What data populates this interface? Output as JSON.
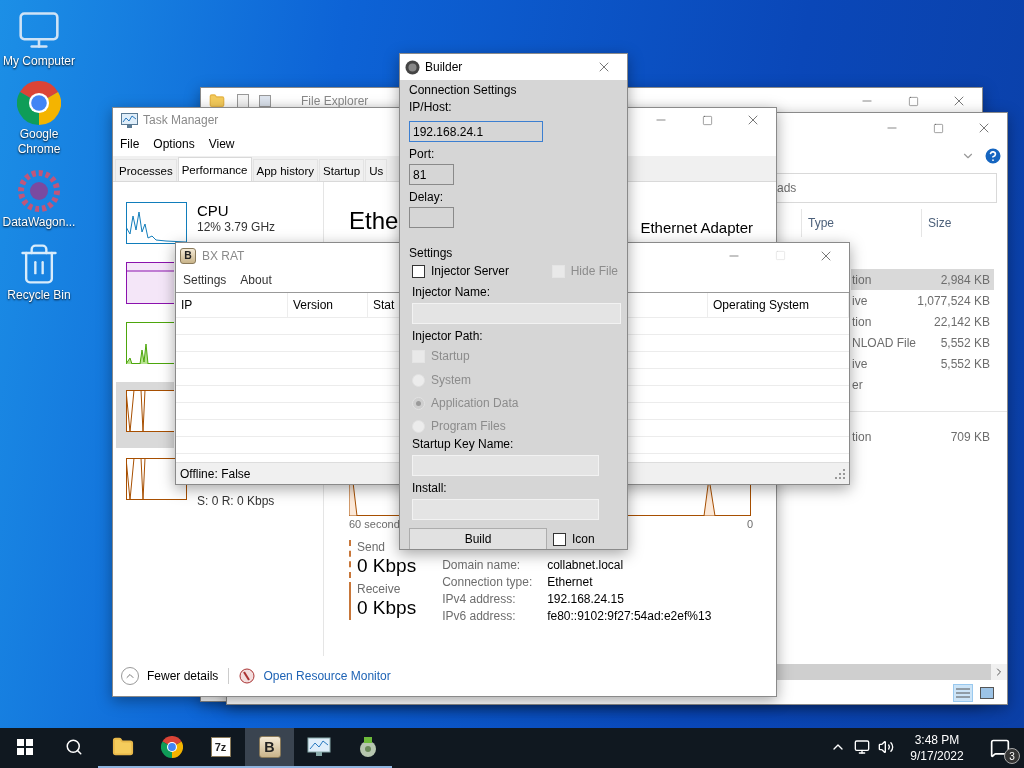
{
  "desktop_icons": [
    {
      "kind": "computer",
      "label": "My Computer"
    },
    {
      "kind": "chrome",
      "label": "Google Chrome"
    },
    {
      "kind": "gear",
      "label": "DataWagon..."
    },
    {
      "kind": "bin",
      "label": "Recycle Bin"
    }
  ],
  "explorer_back": {
    "title": "File Explorer"
  },
  "explorer_front": {
    "search_placeholder": "ads",
    "columns": [
      "Type",
      "Size"
    ],
    "groups": [
      [
        {
          "type": "tion",
          "size": "2,984 KB",
          "selected": true
        },
        {
          "type": "ive",
          "size": "1,077,524 KB",
          "selected": false
        },
        {
          "type": "tion",
          "size": "22,142 KB",
          "selected": false
        },
        {
          "type": "NLOAD File",
          "size": "5,552 KB",
          "selected": false
        },
        {
          "type": "ive",
          "size": "5,552 KB",
          "selected": false
        },
        {
          "type": "er",
          "selected": false
        }
      ],
      [
        {
          "type": "tion",
          "size": "709 KB",
          "selected": false
        }
      ]
    ]
  },
  "task_manager": {
    "title": "Task Manager",
    "menu": [
      "File",
      "Options",
      "View"
    ],
    "tabs": [
      {
        "label": "Processes",
        "selected": false
      },
      {
        "label": "Performance",
        "selected": true
      },
      {
        "label": "App history",
        "selected": false
      },
      {
        "label": "Startup",
        "selected": false
      },
      {
        "label": "Us",
        "selected": false
      }
    ],
    "sidebar": [
      {
        "kind": "cpu",
        "title": "CPU",
        "detail": "12%  3.79 GHz",
        "selected": false
      },
      {
        "kind": "memory",
        "selected": false
      },
      {
        "kind": "disk",
        "selected": false
      },
      {
        "kind": "ethernet",
        "selected": true
      },
      {
        "kind": "ethernet",
        "detail": "S: 0 R: 0 Kbps",
        "selected": false
      }
    ],
    "heading": "Ethe",
    "adapter": "Ethernet Adapter",
    "graph_label": "60 second",
    "graph_end": "0",
    "send": {
      "label": "Send",
      "value": "0 Kbps"
    },
    "receive": {
      "label": "Receive",
      "value": "0 Kbps"
    },
    "properties": [
      {
        "label": "Domain name:",
        "value": "collabnet.local"
      },
      {
        "label": "Connection type:",
        "value": "Ethernet"
      },
      {
        "label": "IPv4 address:",
        "value": "192.168.24.15"
      },
      {
        "label": "IPv6 address:",
        "value": "fe80::9102:9f27:54ad:e2ef%13"
      }
    ],
    "fewer_details": "Fewer details",
    "resource_monitor": "Open Resource Monitor"
  },
  "bx_rat": {
    "title": "BX RAT",
    "icon_letter": "B",
    "menu": [
      "Settings",
      "About"
    ],
    "columns": [
      "IP",
      "Version",
      "Stat",
      "",
      "Operating System"
    ],
    "status": "Offline: False"
  },
  "builder": {
    "title": "Builder",
    "connection_heading": "Connection Settings",
    "ip_label": "IP/Host:",
    "ip_value": "192.168.24.1",
    "port_label": "Port:",
    "port_value": "81",
    "delay_label": "Delay:",
    "settings_heading": "Settings",
    "injector_server": {
      "label": "Injector Server",
      "checked": false,
      "disabled": false
    },
    "hide_file": {
      "label": "Hide File",
      "checked": false,
      "disabled": true
    },
    "injector_name_label": "Injector Name:",
    "injector_path_label": "Injector Path:",
    "startup": {
      "label": "Startup",
      "checked": false,
      "disabled": true
    },
    "paths": [
      {
        "label": "System",
        "selected": false
      },
      {
        "label": "Application Data",
        "selected": true
      },
      {
        "label": "Program Files",
        "selected": false
      }
    ],
    "startup_key_label": "Startup Key Name:",
    "install_label": "Install:",
    "build": "Build",
    "icon": {
      "label": "Icon",
      "checked": false,
      "disabled": false
    }
  },
  "taskbar": {
    "apps": [
      {
        "kind": "explorer",
        "selected": false
      },
      {
        "kind": "chrome",
        "selected": false
      },
      {
        "kind": "archiver",
        "label": "7z",
        "selected": false
      },
      {
        "kind": "bx",
        "label": "B",
        "selected": true
      },
      {
        "kind": "taskmgr",
        "selected": false
      },
      {
        "kind": "installer",
        "selected": false
      }
    ],
    "time": "3:48 PM",
    "date": "9/17/2022",
    "notifications": "3"
  }
}
